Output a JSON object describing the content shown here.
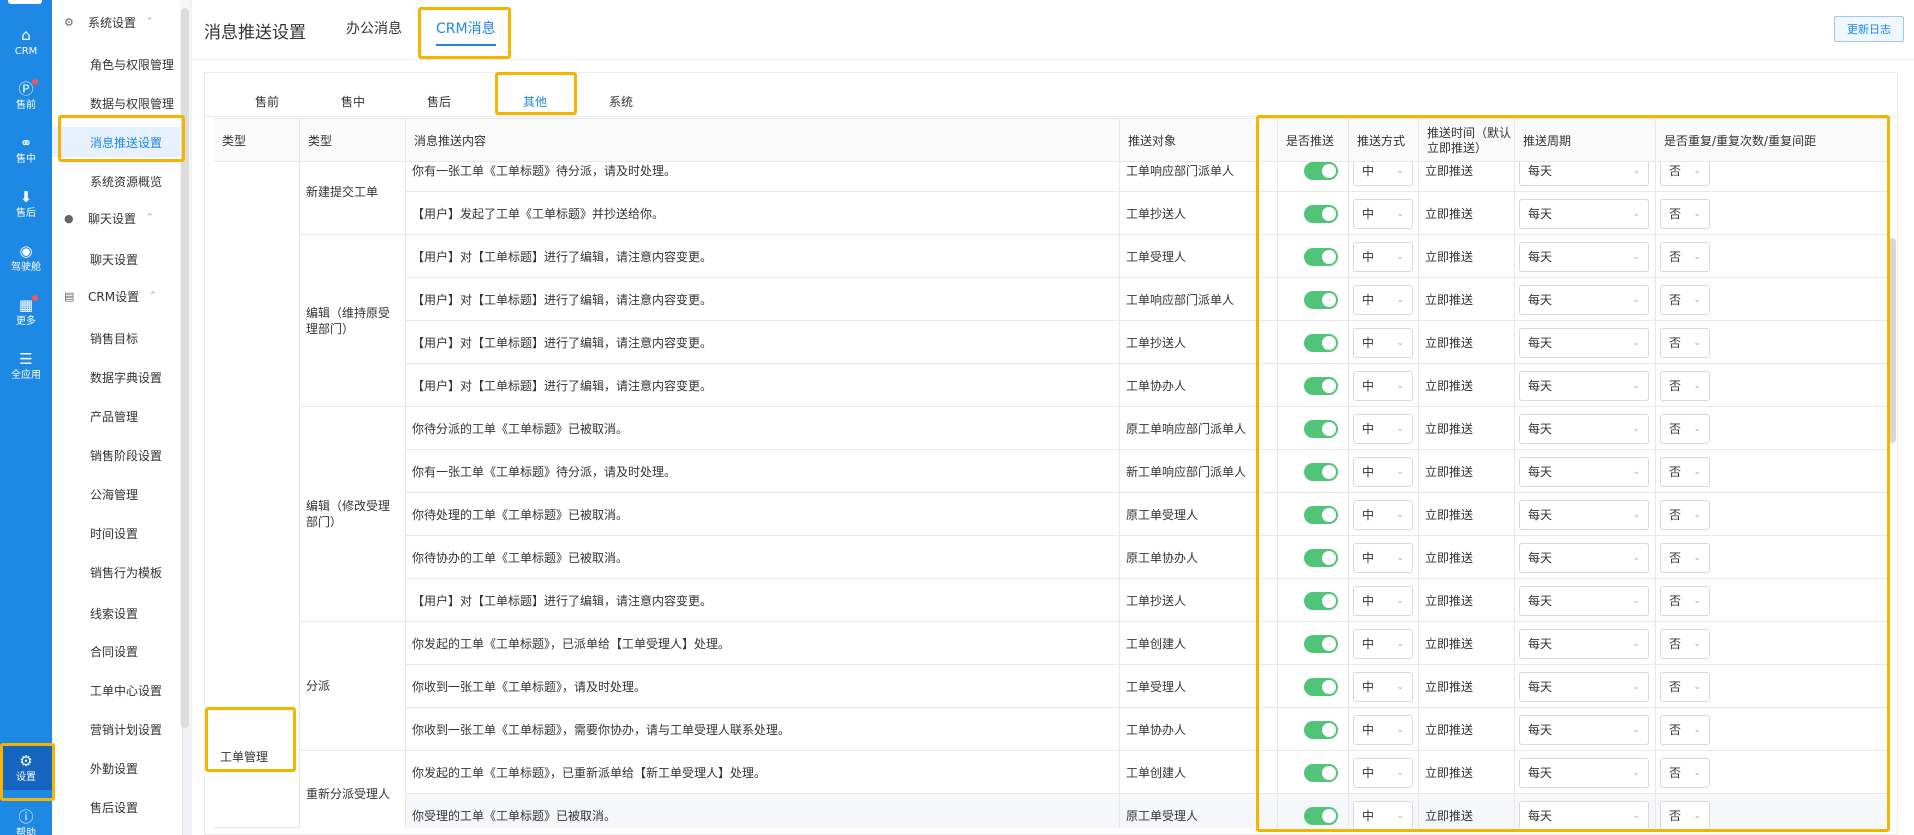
{
  "rail": {
    "items": [
      {
        "label": "CRM",
        "icon": "home-icon"
      },
      {
        "label": "售前",
        "icon": "pinterest-icon"
      },
      {
        "label": "售中",
        "icon": "handshake-icon"
      },
      {
        "label": "售后",
        "icon": "download-icon"
      },
      {
        "label": "驾驶舱",
        "icon": "dashboard-icon"
      },
      {
        "label": "更多",
        "icon": "grid-icon"
      },
      {
        "label": "全应用",
        "icon": "menu-icon"
      },
      {
        "label": "设置",
        "icon": "gear-icon"
      },
      {
        "label": "帮助",
        "icon": "help-icon"
      }
    ]
  },
  "submenu": {
    "groups": [
      {
        "label": "系统设置",
        "items": [
          "角色与权限管理",
          "数据与权限管理",
          "消息推送设置",
          "系统资源概览"
        ]
      },
      {
        "label": "聊天设置",
        "items": [
          "聊天设置"
        ]
      },
      {
        "label": "CRM设置",
        "items": [
          "销售目标",
          "数据字典设置",
          "产品管理",
          "销售阶段设置",
          "公海管理",
          "时间设置",
          "销售行为模板",
          "线索设置",
          "合同设置",
          "工单中心设置",
          "营销计划设置",
          "外勤设置",
          "售后设置"
        ]
      }
    ],
    "active": "消息推送设置"
  },
  "header": {
    "title": "消息推送设置",
    "tabs": [
      "办公消息",
      "CRM消息"
    ],
    "active_tab": "CRM消息",
    "log_button": "更新日志"
  },
  "sub_tabs": {
    "items": [
      "售前",
      "售中",
      "售后",
      "其他",
      "系统"
    ],
    "active": "其他"
  },
  "table": {
    "columns": [
      "类型",
      "类型",
      "消息推送内容",
      "推送对象",
      "是否推送",
      "推送方式",
      "推送时间（默认立即推送）",
      "推送周期",
      "是否重复/重复次数/重复间距"
    ],
    "category": "工单管理",
    "groups": [
      {
        "label": "新建提交工单",
        "rows": 2
      },
      {
        "label": "编辑（维持原受理部门）",
        "rows": 4
      },
      {
        "label": "编辑（修改受理部门）",
        "rows": 5
      },
      {
        "label": "分派",
        "rows": 3
      },
      {
        "label": "重新分派受理人",
        "rows": 2
      }
    ],
    "rows": [
      {
        "content": "你有一张工单《工单标题》待分派，请及时处理。",
        "target": "工单响应部门派单人",
        "mode": "中",
        "time": "立即推送",
        "cycle": "每天",
        "repeat": "否"
      },
      {
        "content": "【用户】发起了工单《工单标题》并抄送给你。",
        "target": "工单抄送人",
        "mode": "中",
        "time": "立即推送",
        "cycle": "每天",
        "repeat": "否"
      },
      {
        "content": "【用户】对【工单标题】进行了编辑，请注意内容变更。",
        "target": "工单受理人",
        "mode": "中",
        "time": "立即推送",
        "cycle": "每天",
        "repeat": "否"
      },
      {
        "content": "【用户】对【工单标题】进行了编辑，请注意内容变更。",
        "target": "工单响应部门派单人",
        "mode": "中",
        "time": "立即推送",
        "cycle": "每天",
        "repeat": "否"
      },
      {
        "content": "【用户】对【工单标题】进行了编辑，请注意内容变更。",
        "target": "工单抄送人",
        "mode": "中",
        "time": "立即推送",
        "cycle": "每天",
        "repeat": "否"
      },
      {
        "content": "【用户】对【工单标题】进行了编辑，请注意内容变更。",
        "target": "工单协办人",
        "mode": "中",
        "time": "立即推送",
        "cycle": "每天",
        "repeat": "否"
      },
      {
        "content": "你待分派的工单《工单标题》已被取消。",
        "target": "原工单响应部门派单人",
        "mode": "中",
        "time": "立即推送",
        "cycle": "每天",
        "repeat": "否"
      },
      {
        "content": "你有一张工单《工单标题》待分派，请及时处理。",
        "target": "新工单响应部门派单人",
        "mode": "中",
        "time": "立即推送",
        "cycle": "每天",
        "repeat": "否"
      },
      {
        "content": "你待处理的工单《工单标题》已被取消。",
        "target": "原工单受理人",
        "mode": "中",
        "time": "立即推送",
        "cycle": "每天",
        "repeat": "否"
      },
      {
        "content": "你待协办的工单《工单标题》已被取消。",
        "target": "原工单协办人",
        "mode": "中",
        "time": "立即推送",
        "cycle": "每天",
        "repeat": "否"
      },
      {
        "content": "【用户】对【工单标题】进行了编辑，请注意内容变更。",
        "target": "工单抄送人",
        "mode": "中",
        "time": "立即推送",
        "cycle": "每天",
        "repeat": "否"
      },
      {
        "content": "你发起的工单《工单标题》，已派单给【工单受理人】处理。",
        "target": "工单创建人",
        "mode": "中",
        "time": "立即推送",
        "cycle": "每天",
        "repeat": "否"
      },
      {
        "content": "你收到一张工单《工单标题》，请及时处理。",
        "target": "工单受理人",
        "mode": "中",
        "time": "立即推送",
        "cycle": "每天",
        "repeat": "否"
      },
      {
        "content": "你收到一张工单《工单标题》，需要你协办，请与工单受理人联系处理。",
        "target": "工单协办人",
        "mode": "中",
        "time": "立即推送",
        "cycle": "每天",
        "repeat": "否"
      },
      {
        "content": "你发起的工单《工单标题》，已重新派单给【新工单受理人】处理。",
        "target": "工单创建人",
        "mode": "中",
        "time": "立即推送",
        "cycle": "每天",
        "repeat": "否"
      },
      {
        "content": "你受理的工单《工单标题》已被取消。",
        "target": "原工单受理人",
        "mode": "中",
        "time": "立即推送",
        "cycle": "每天",
        "repeat": "否"
      }
    ]
  },
  "colors": {
    "accent": "#1e88e5",
    "toggle_on": "#52c47a",
    "highlight": "#f5b400"
  }
}
